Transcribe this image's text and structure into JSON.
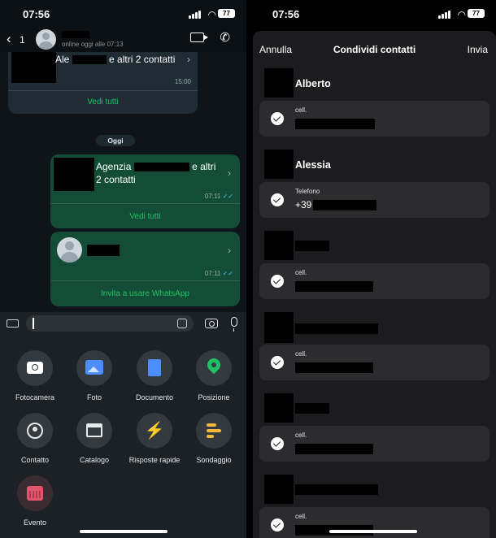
{
  "left": {
    "status": {
      "time": "07:56",
      "battery": "77"
    },
    "header": {
      "back_count": "1",
      "subtitle": "online oggi alle 07:13"
    },
    "messages": {
      "first": {
        "text_prefix": "Ale",
        "text_suffix": "e altri 2 contatti",
        "time": "15:00",
        "link": "Vedi tutti"
      },
      "day_separator": "Oggi",
      "second": {
        "line1_prefix": "Agenzia",
        "line1_suffix": "e altri",
        "line2": "2 contatti",
        "time": "07:11",
        "ticks": "✓✓",
        "link": "Vedi tutti"
      },
      "third": {
        "time": "07:11",
        "ticks": "✓✓",
        "link": "Invita a usare WhatsApp"
      }
    },
    "attach": [
      {
        "label": "Fotocamera",
        "icon": "camera-icon"
      },
      {
        "label": "Foto",
        "icon": "photo-icon"
      },
      {
        "label": "Documento",
        "icon": "document-icon"
      },
      {
        "label": "Posizione",
        "icon": "location-icon"
      },
      {
        "label": "Contatto",
        "icon": "contact-icon"
      },
      {
        "label": "Catalogo",
        "icon": "catalog-icon"
      },
      {
        "label": "Risposte rapide",
        "icon": "lightning-icon"
      },
      {
        "label": "Sondaggio",
        "icon": "poll-icon"
      },
      {
        "label": "Evento",
        "icon": "calendar-icon"
      }
    ],
    "colors": {
      "accent": "#21c063",
      "outgoing_bubble": "#144d37",
      "incoming_bubble": "#1f2c34"
    }
  },
  "right": {
    "status": {
      "time": "07:56",
      "battery": "77"
    },
    "sheet": {
      "cancel": "Annulla",
      "title": "Condividi contatti",
      "send": "Invia"
    },
    "contacts": [
      {
        "name": "Alberto",
        "type": "cell.",
        "value": ""
      },
      {
        "name": "Alessia",
        "type": "Telefono",
        "value": "+39"
      },
      {
        "name": "",
        "type": "cell.",
        "value": ""
      },
      {
        "name": "",
        "type": "cell.",
        "value": ""
      },
      {
        "name": "",
        "type": "cell.",
        "value": ""
      },
      {
        "name": "",
        "type": "cell.",
        "value": ""
      }
    ]
  }
}
